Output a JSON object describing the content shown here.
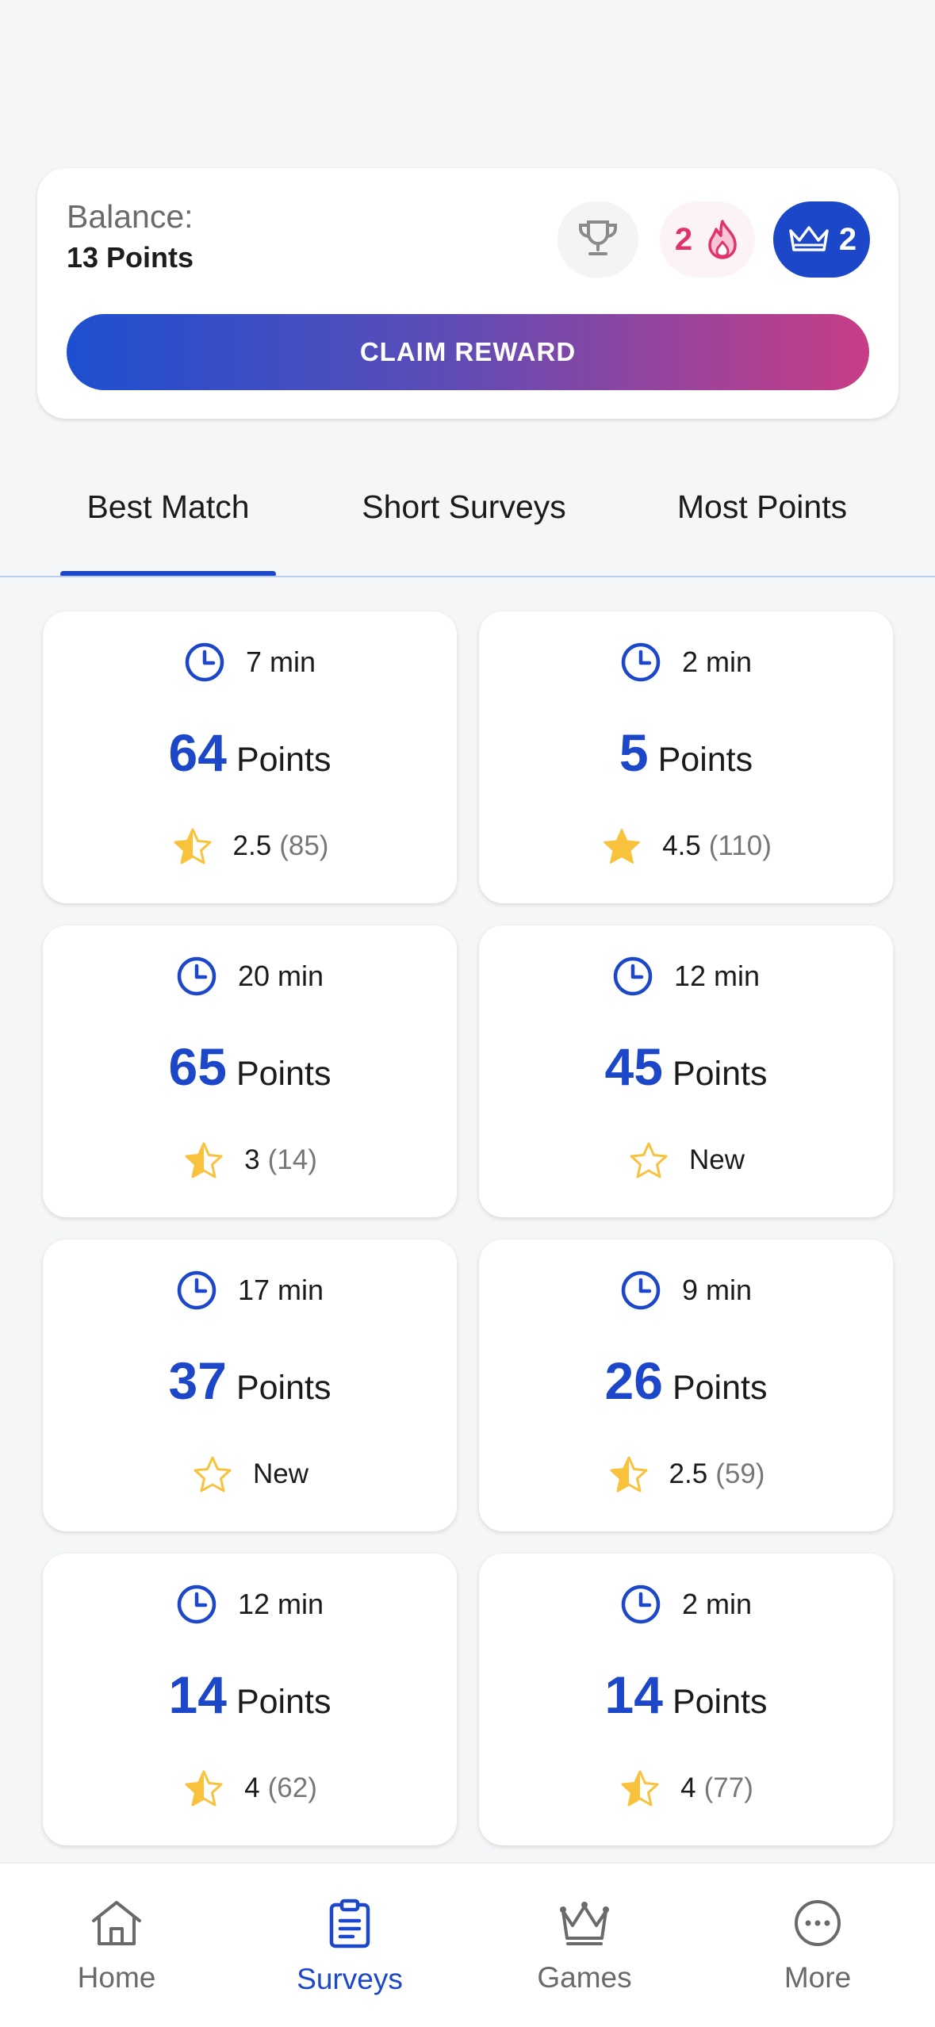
{
  "balance": {
    "label": "Balance:",
    "value": "13 Points",
    "streak_count": "2",
    "crown_count": "2",
    "claim_label": "CLAIM REWARD"
  },
  "tabs": [
    {
      "label": "Best Match",
      "active": true
    },
    {
      "label": "Short Surveys",
      "active": false
    },
    {
      "label": "Most Points",
      "active": false
    }
  ],
  "surveys": [
    {
      "time": "7 min",
      "points": "64",
      "points_label": "Points",
      "rating": "2.5",
      "count": "(85)",
      "star": "half"
    },
    {
      "time": "2 min",
      "points": "5",
      "points_label": "Points",
      "rating": "4.5",
      "count": "(110)",
      "star": "full"
    },
    {
      "time": "20 min",
      "points": "65",
      "points_label": "Points",
      "rating": "3",
      "count": "(14)",
      "star": "half"
    },
    {
      "time": "12 min",
      "points": "45",
      "points_label": "Points",
      "rating": "New",
      "count": "",
      "star": "empty"
    },
    {
      "time": "17 min",
      "points": "37",
      "points_label": "Points",
      "rating": "New",
      "count": "",
      "star": "empty"
    },
    {
      "time": "9 min",
      "points": "26",
      "points_label": "Points",
      "rating": "2.5",
      "count": "(59)",
      "star": "half"
    },
    {
      "time": "12 min",
      "points": "14",
      "points_label": "Points",
      "rating": "4",
      "count": "(62)",
      "star": "half"
    },
    {
      "time": "2 min",
      "points": "14",
      "points_label": "Points",
      "rating": "4",
      "count": "(77)",
      "star": "half"
    }
  ],
  "nav": [
    {
      "label": "Home",
      "icon": "home-icon",
      "active": false
    },
    {
      "label": "Surveys",
      "icon": "clipboard-icon",
      "active": true
    },
    {
      "label": "Games",
      "icon": "crown-icon",
      "active": false
    },
    {
      "label": "More",
      "icon": "more-icon",
      "active": false
    }
  ],
  "colors": {
    "accent": "#1d47c9",
    "streak": "#e0336e",
    "star": "#f9c23c",
    "gradient_start": "#1d4fd0",
    "gradient_end": "#c83d86"
  }
}
